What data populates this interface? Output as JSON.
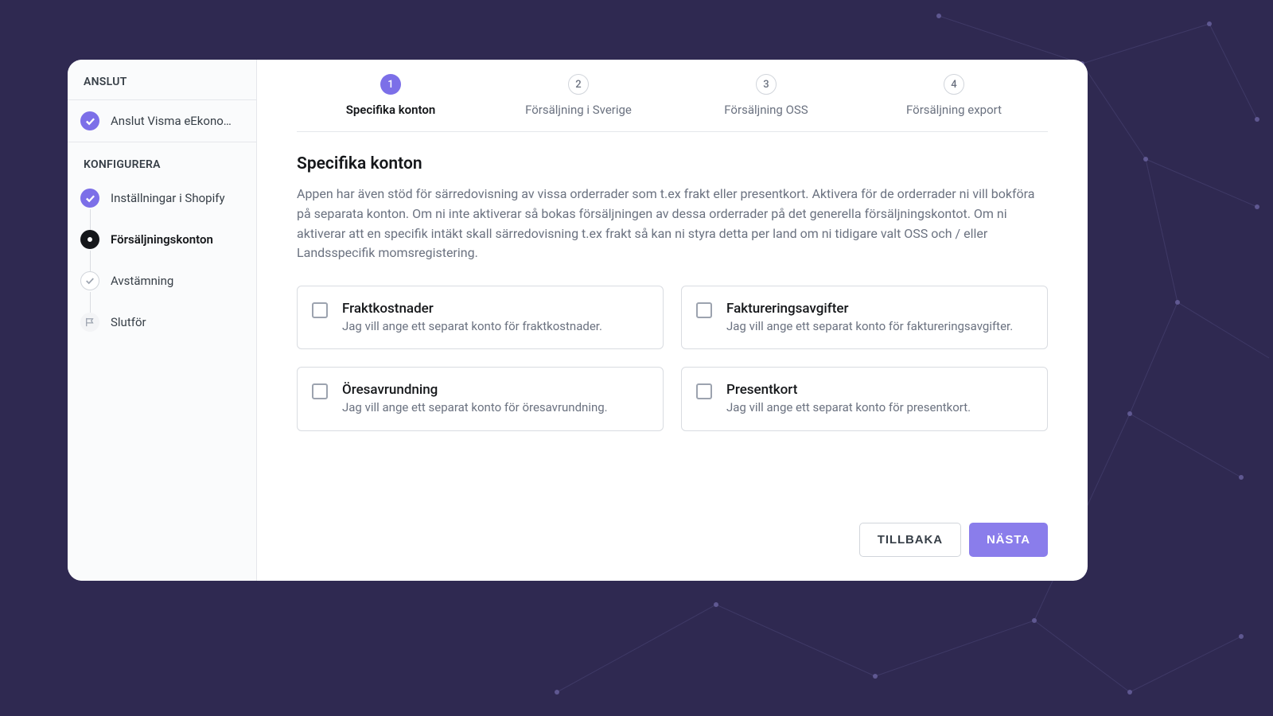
{
  "sidebar": {
    "section1_label": "ANSLUT",
    "section2_label": "KONFIGURERA",
    "items": [
      {
        "label": "Anslut Visma eEkono…",
        "status": "completed"
      },
      {
        "label": "Inställningar i Shopify",
        "status": "completed"
      },
      {
        "label": "Försäljningskonton",
        "status": "current"
      },
      {
        "label": "Avstämning",
        "status": "pending"
      },
      {
        "label": "Slutför",
        "status": "flag"
      }
    ]
  },
  "stepper": [
    {
      "num": "1",
      "label": "Specifika konton",
      "active": true
    },
    {
      "num": "2",
      "label": "Försäljning i Sverige",
      "active": false
    },
    {
      "num": "3",
      "label": "Försäljning OSS",
      "active": false
    },
    {
      "num": "4",
      "label": "Försäljning export",
      "active": false
    }
  ],
  "content": {
    "title": "Specifika konton",
    "description": "Appen har även stöd för särredovisning av vissa orderrader som t.ex frakt eller presentkort. Aktivera för de orderrader ni vill bokföra på separata konton. Om ni inte aktiverar så bokas försäljningen av dessa orderrader på det generella försäljningskontot. Om ni aktiverar att en specifik intäkt skall särredovisning t.ex frakt så kan ni styra detta per land om ni tidigare valt OSS och / eller Landsspecifik momsregistering."
  },
  "cards": [
    {
      "title": "Fraktkostnader",
      "desc": "Jag vill ange ett separat konto för fraktkostnader."
    },
    {
      "title": "Faktureringsavgifter",
      "desc": "Jag vill ange ett separat konto för faktureringsavgifter."
    },
    {
      "title": "Öresavrundning",
      "desc": "Jag vill ange ett separat konto för öresavrundning."
    },
    {
      "title": "Presentkort",
      "desc": "Jag vill ange ett separat konto för presentkort."
    }
  ],
  "footer": {
    "back": "TILLBAKA",
    "next": "NÄSTA"
  }
}
